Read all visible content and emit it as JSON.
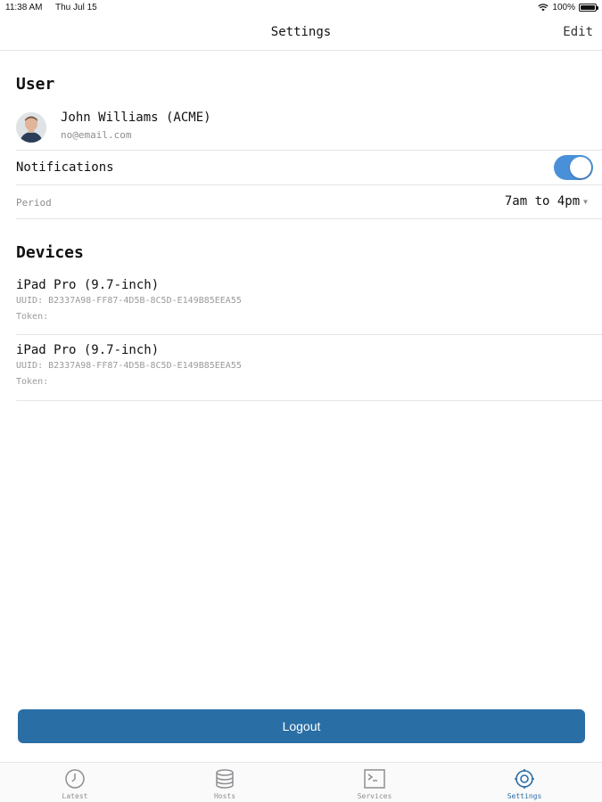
{
  "status_bar": {
    "time": "11:38 AM",
    "date": "Thu Jul 15",
    "battery_text": "100%",
    "battery_level": 1.0
  },
  "nav": {
    "title": "Settings",
    "edit_label": "Edit"
  },
  "user_section": {
    "title": "User",
    "name": "John Williams (ACME)",
    "email": "no@email.com",
    "notifications_label": "Notifications",
    "notifications_on": true,
    "period_label": "Period",
    "period_value": "7am to 4pm"
  },
  "devices_section": {
    "title": "Devices",
    "devices": [
      {
        "name": "iPad Pro (9.7-inch)",
        "uuid": "UUID: B2337A98-FF87-4D5B-8C5D-E149B85EEA55",
        "token": "Token:"
      },
      {
        "name": "iPad Pro (9.7-inch)",
        "uuid": "UUID: B2337A98-FF87-4D5B-8C5D-E149B85EEA55",
        "token": "Token:"
      }
    ]
  },
  "logout_label": "Logout",
  "tabs": [
    {
      "label": "Latest",
      "icon": "clock-icon"
    },
    {
      "label": "Hosts",
      "icon": "database-icon"
    },
    {
      "label": "Services",
      "icon": "terminal-icon"
    },
    {
      "label": "Settings",
      "icon": "gear-icon",
      "active": true
    }
  ],
  "colors": {
    "accent": "#2a6ea6",
    "toggle_on": "#4a90d9",
    "secondary_text": "#8e8e93"
  }
}
